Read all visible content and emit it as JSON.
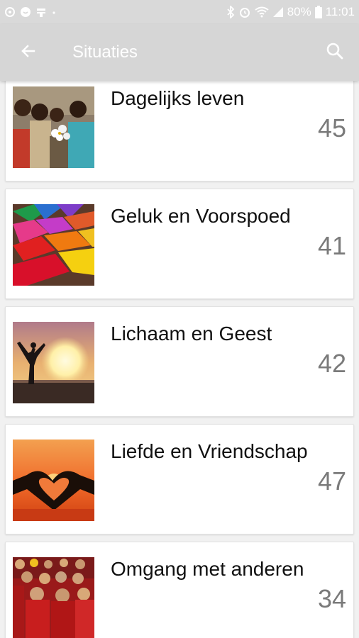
{
  "status_bar": {
    "battery": "80%",
    "time": "11:01",
    "icons": [
      "cast-icon",
      "whatsapp-icon",
      "app-icon",
      "dot-icon",
      "bluetooth-icon",
      "alarm-icon",
      "wifi-icon",
      "signal-icon",
      "battery-icon"
    ]
  },
  "app_bar": {
    "title": "Situaties",
    "back_icon": "arrow-left-icon",
    "search_icon": "search-icon"
  },
  "categories": [
    {
      "title": "Dagelijks leven",
      "count": "45",
      "image": "children-holding-flowers"
    },
    {
      "title": "Geluk en Voorspoed",
      "count": "41",
      "image": "colored-powder-trays"
    },
    {
      "title": "Lichaam en Geest",
      "count": "42",
      "image": "silhouette-sunset"
    },
    {
      "title": "Liefde en Vriendschap",
      "count": "47",
      "image": "heart-hands-sunset"
    },
    {
      "title": "Omgang met anderen",
      "count": "34",
      "image": "monks-crowd"
    }
  ]
}
